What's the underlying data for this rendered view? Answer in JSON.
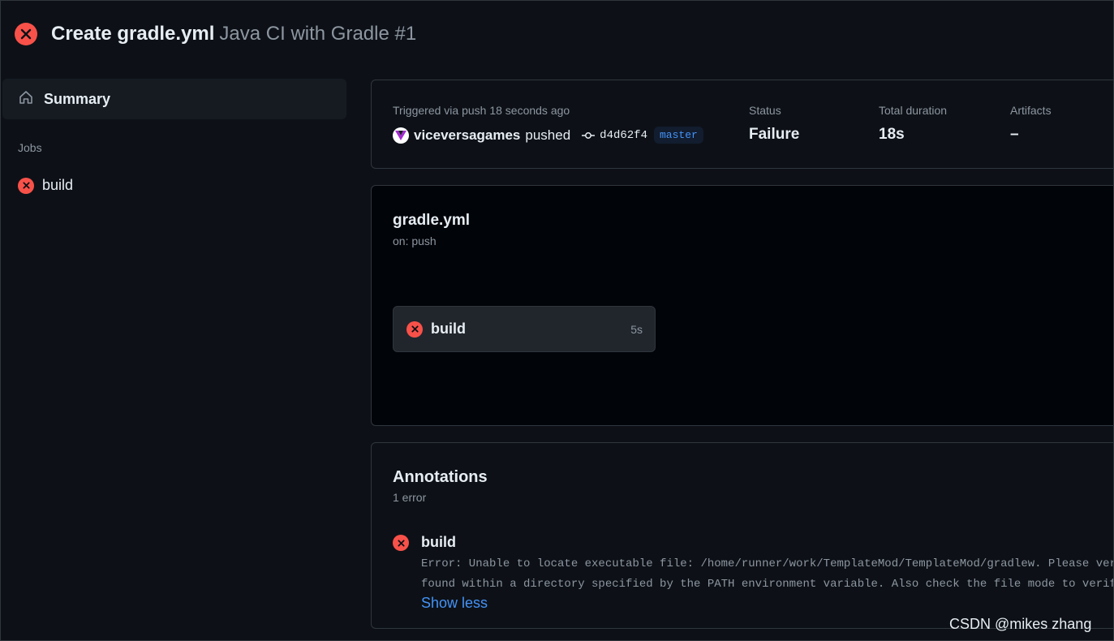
{
  "header": {
    "title": "Create gradle.yml",
    "subtitle": "Java CI with Gradle #1",
    "status_icon": "x-circle-icon",
    "status_color": "#f85149"
  },
  "sidebar": {
    "summary_label": "Summary",
    "jobs_heading": "Jobs",
    "jobs": [
      {
        "label": "build",
        "status": "failure"
      }
    ]
  },
  "run_summary": {
    "trigger_text": "Triggered via push 18 seconds ago",
    "actor": "viceversagames",
    "action": "pushed",
    "commit": "d4d62f4",
    "branch": "master",
    "status_label": "Status",
    "status_value": "Failure",
    "duration_label": "Total duration",
    "duration_value": "18s",
    "artifacts_label": "Artifacts",
    "artifacts_value": "–"
  },
  "workflow": {
    "name": "gradle.yml",
    "trigger": "on: push",
    "job": {
      "label": "build",
      "duration": "5s",
      "status": "failure"
    }
  },
  "annotations": {
    "title": "Annotations",
    "count": "1 error",
    "items": [
      {
        "job": "build",
        "message_line1": "Error: Unable to locate executable file: /home/runner/work/TemplateMod/TemplateMod/gradlew. Please verify either the file path exists or the file can be",
        "message_line2": "found within a directory specified by the PATH environment variable. Also check the file mode to verify the file is executable."
      }
    ],
    "toggle_label": "Show less"
  },
  "watermark": "CSDN @mikes  zhang",
  "colors": {
    "background": "#0d1117",
    "error": "#f85149",
    "link": "#4493f8",
    "muted": "#8d96a0"
  }
}
